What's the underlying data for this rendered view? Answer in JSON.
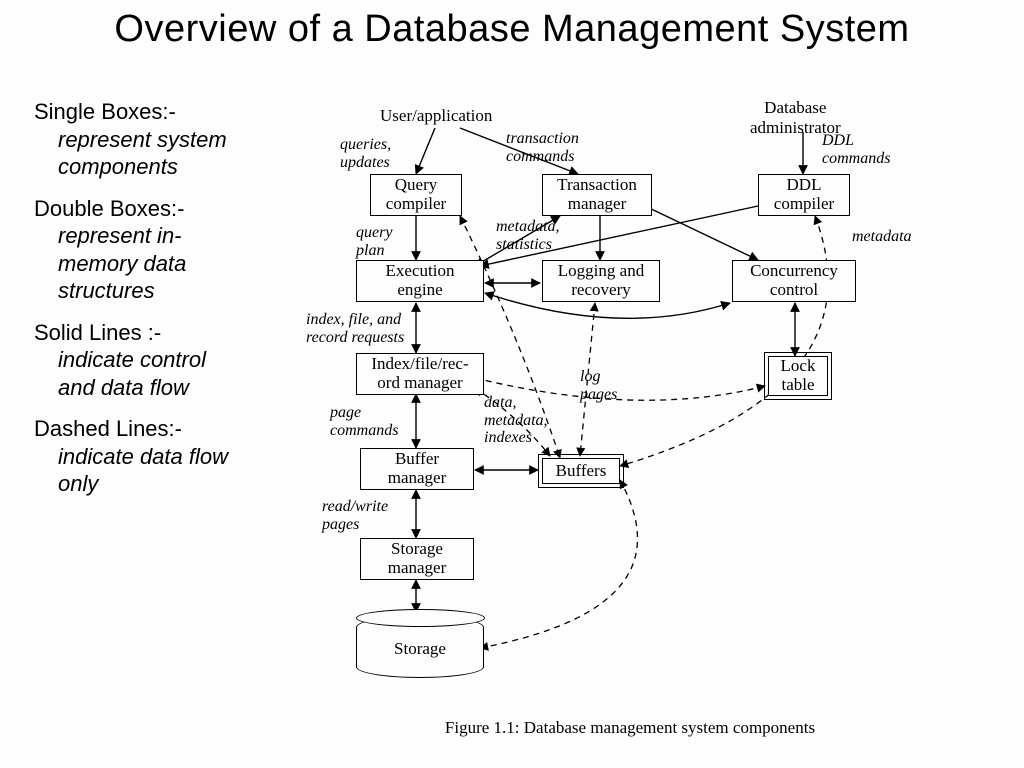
{
  "title": "Overview of a Database Management System",
  "legend": [
    {
      "term": "Single Boxes:-",
      "defn": "represent system components"
    },
    {
      "term": "Double Boxes:-",
      "defn": "represent in-memory data structures"
    },
    {
      "term": "Solid Lines :-",
      "defn": "indicate control and data flow"
    },
    {
      "term": "Dashed Lines:-",
      "defn": "indicate data flow only"
    }
  ],
  "actors": {
    "user": "User/application",
    "dba": "Database\nadministrator"
  },
  "nodes": {
    "query_compiler": "Query\ncompiler",
    "transaction_manager": "Transaction\nmanager",
    "ddl_compiler": "DDL\ncompiler",
    "execution_engine": "Execution\nengine",
    "logging_recovery": "Logging and\nrecovery",
    "concurrency_control": "Concurrency\ncontrol",
    "index_file_mgr": "Index/file/rec-\nord manager",
    "lock_table": "Lock\ntable",
    "buffer_manager": "Buffer\nmanager",
    "buffers": "Buffers",
    "storage_manager": "Storage\nmanager",
    "storage": "Storage"
  },
  "edge_labels": {
    "queries_updates": "queries,\nupdates",
    "transaction_commands": "transaction\ncommands",
    "ddl_commands": "DDL\ncommands",
    "query_plan": "query\nplan",
    "metadata_statistics": "metadata,\nstatistics",
    "metadata": "metadata",
    "index_file_record_requests": "index, file, and\nrecord requests",
    "log_pages": "log\npages",
    "page_commands": "page\ncommands",
    "data_metadata_indexes": "data,\nmetadata,\nindexes",
    "read_write_pages": "read/write\npages"
  },
  "caption": "Figure 1.1: Database management system components"
}
